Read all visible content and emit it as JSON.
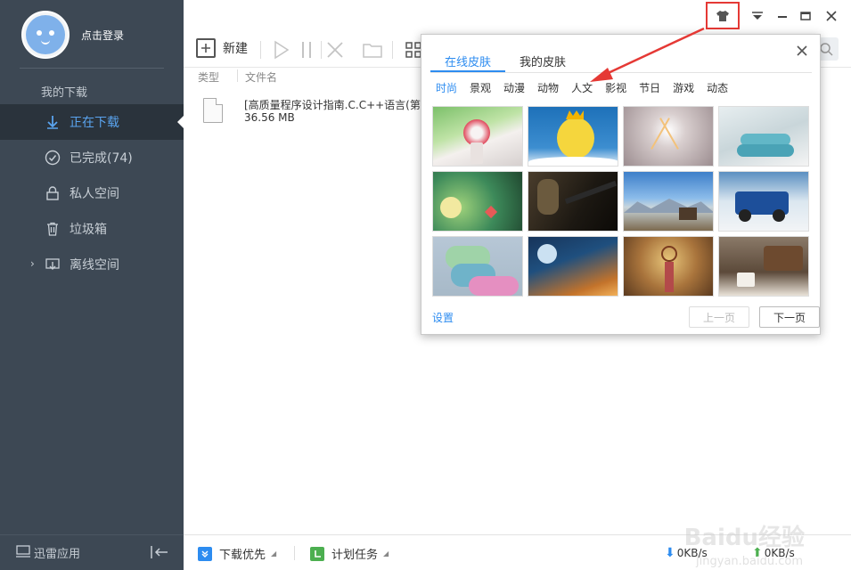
{
  "sidebar": {
    "login_text": "点击登录",
    "section_title": "我的下载",
    "items": [
      {
        "label": "正在下载",
        "icon": "download-arrow-icon"
      },
      {
        "label": "已完成(74)",
        "icon": "check-circle-icon"
      },
      {
        "label": "私人空间",
        "icon": "lock-icon"
      },
      {
        "label": "垃圾箱",
        "icon": "trash-icon"
      },
      {
        "label": "离线空间",
        "icon": "cloud-download-icon"
      }
    ],
    "bottom_label": "迅雷应用"
  },
  "toolbar": {
    "new_label": "新建"
  },
  "list": {
    "col_type": "类型",
    "col_filename": "文件名",
    "file": {
      "name": "[高质量程序设计指南.C.C++语言(第三",
      "size": "36.56 MB"
    }
  },
  "statusbar": {
    "priority_label": "下载优先",
    "schedule_label": "计划任务",
    "down_speed": "0KB/s",
    "up_speed": "0KB/s"
  },
  "skin_popup": {
    "tabs": [
      "在线皮肤",
      "我的皮肤"
    ],
    "categories": [
      "时尚",
      "景观",
      "动漫",
      "动物",
      "人文",
      "影视",
      "节日",
      "游戏",
      "动态"
    ],
    "settings_label": "设置",
    "prev_label": "上一页",
    "next_label": "下一页"
  },
  "watermark": {
    "main": "Baidu经验",
    "sub": "jingyan.baidu.com"
  },
  "colors": {
    "sidebar_bg": "#3d4854",
    "accent": "#2d8cf0",
    "highlight": "#e53935"
  }
}
